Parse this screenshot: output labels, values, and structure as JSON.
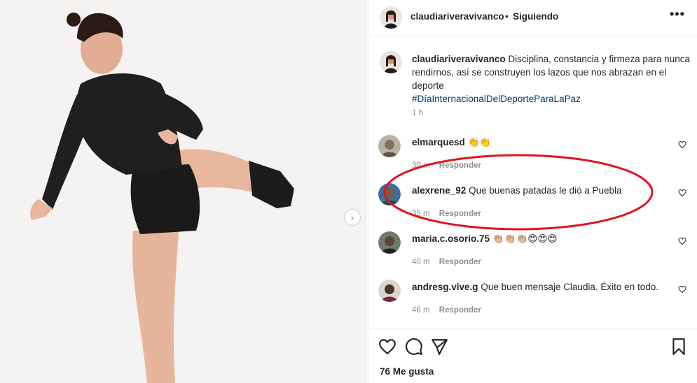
{
  "post": {
    "username": "claudiariveravivanco",
    "separator": "•",
    "follow_status": "Siguiendo",
    "more_label": "•••",
    "caption_username": "claudiariveravivanco",
    "caption_text": "Disciplina, constancia y firmeza para nunca rendirnos, así se construyen los lazos que nos abrazan en el deporte",
    "hashtag": "#DíaInternacionalDelDeporteParaLaPaz",
    "caption_time": "1 h",
    "likes": "76 Me gusta",
    "next_label": "›"
  },
  "comments": [
    {
      "user": "elmarquesd",
      "text": "👏👏",
      "time": "30 m",
      "reply": "Responder"
    },
    {
      "user": "alexrene_92",
      "text": "Que buenas patadas le dió a Puebla",
      "time": "35 m",
      "reply": "Responder"
    },
    {
      "user": "maria.c.osorio.75",
      "text": "👏🏼👏🏼👏🏼😍😍😍",
      "time": "40 m",
      "reply": "Responder"
    },
    {
      "user": "andresg.vive.g",
      "text": "Que buen mensaje Claudia. Éxito en todo.",
      "time": "46 m",
      "reply": "Responder"
    }
  ],
  "colors": {
    "hashtag": "#00376b",
    "secondary_text": "#8e8e8e",
    "highlight": "#e0141f"
  }
}
